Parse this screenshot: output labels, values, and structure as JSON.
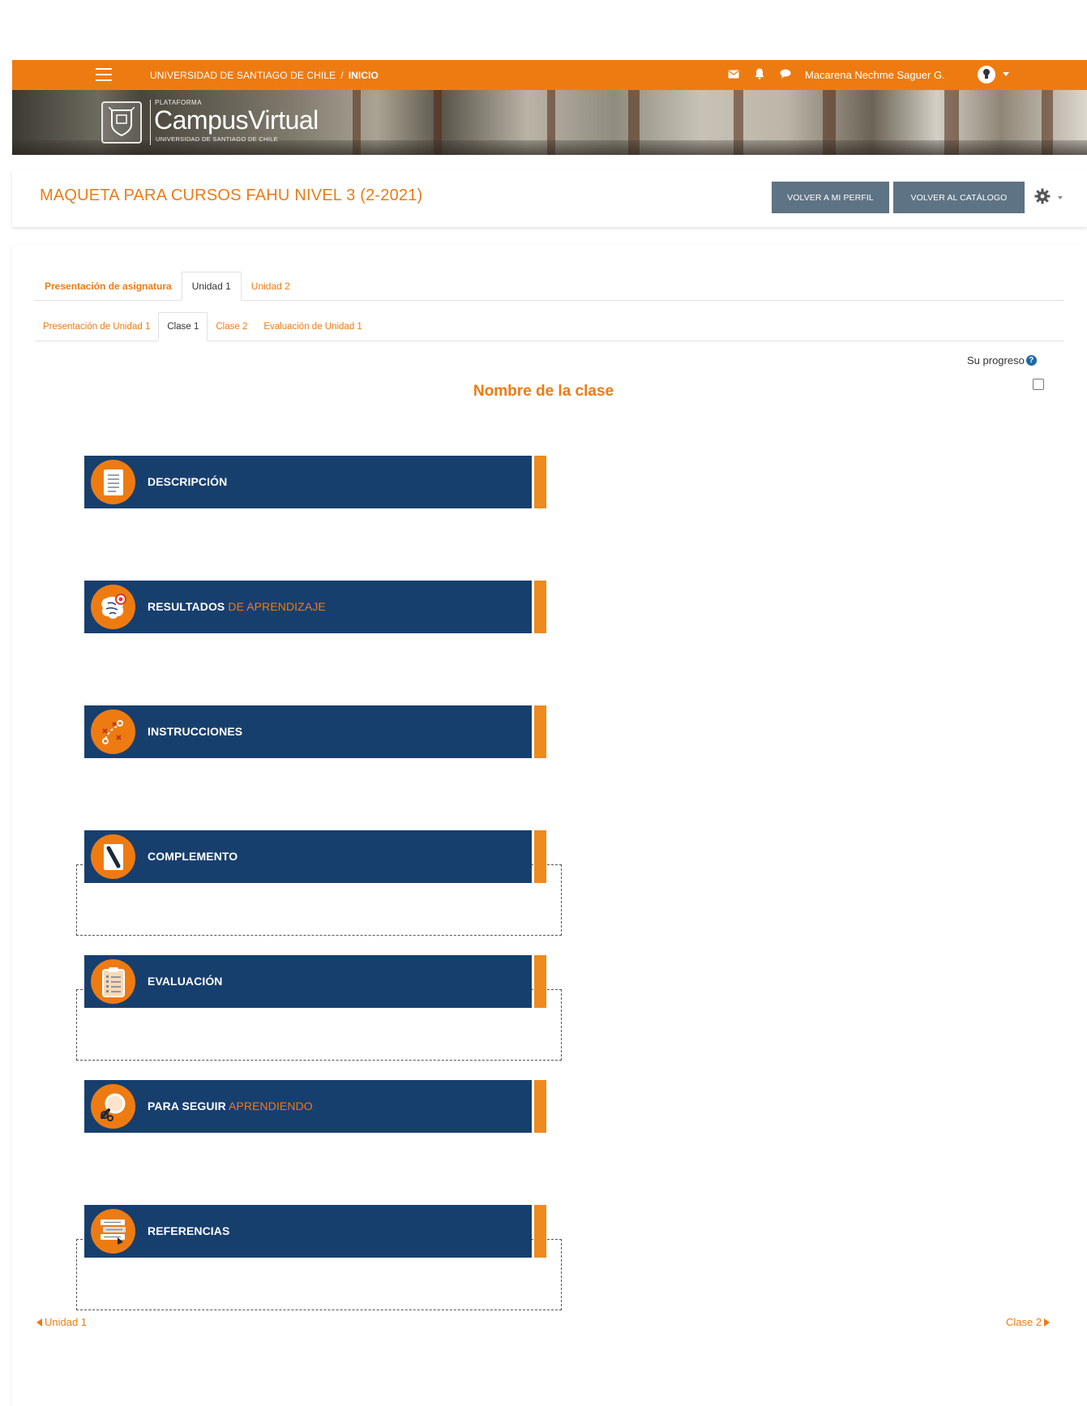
{
  "topbar": {
    "crumb_root": "UNIVERSIDAD DE SANTIAGO DE CHILE",
    "crumb_separator": "/",
    "crumb_current": "INICIO",
    "user_name": "Macarena Nechme Saguer G.",
    "icons": [
      "menu-icon",
      "envelope-icon",
      "bell-icon",
      "chat-icon",
      "user-avatar-icon",
      "caret-down-icon"
    ],
    "bg_color": "#ee7b12"
  },
  "banner": {
    "logo_small": "PLATAFORMA",
    "logo_main": "CampusVirtual",
    "logo_sub": "UNIVERSIDAD DE SANTIAGO DE CHILE"
  },
  "course": {
    "title": "MAQUETA PARA CURSOS FAHU NIVEL 3 (2-2021)",
    "btn_profile": "VOLVER A MI PERFIL",
    "btn_catalog": "VOLVER AL CATÁLOGO",
    "title_color": "#ee7b12",
    "button_color": "#5e7384"
  },
  "tabs_level1": [
    {
      "label": "Presentación de asignatura",
      "active": false
    },
    {
      "label": "Unidad 1",
      "active": true
    },
    {
      "label": "Unidad 2",
      "active": false
    }
  ],
  "tabs_level2": [
    {
      "label": "Presentación de Unidad 1",
      "active": false
    },
    {
      "label": "Clase 1",
      "active": true
    },
    {
      "label": "Clase 2",
      "active": false
    },
    {
      "label": "Evaluación de Unidad 1",
      "active": false
    }
  ],
  "progress": {
    "label": "Su progreso",
    "help": "?"
  },
  "section": {
    "title": "Nombre de la clase"
  },
  "activities": [
    {
      "main": "DESCRIPCIÓN",
      "accent": "",
      "icon": "document-icon",
      "dashed": false
    },
    {
      "main": "RESULTADOS",
      "accent": " DE APRENDIZAJE",
      "icon": "brain-target-icon",
      "dashed": false
    },
    {
      "main": "INSTRUCCIONES",
      "accent": "",
      "icon": "strategy-icon",
      "dashed": false
    },
    {
      "main": "COMPLEMENTO",
      "accent": "",
      "icon": "pencil-icon",
      "dashed": true
    },
    {
      "main": "EVALUACIÓN",
      "accent": "",
      "icon": "clipboard-icon",
      "dashed": true
    },
    {
      "main": "PARA SEGUIR",
      "accent": " APRENDIENDO",
      "icon": "magnifier-gears-icon",
      "dashed": false
    },
    {
      "main": "REFERENCIAS",
      "accent": "",
      "icon": "books-icon",
      "dashed": true
    }
  ],
  "navigation": {
    "prev": "Unidad 1",
    "next": "Clase 2"
  },
  "colors": {
    "accent": "#ee7b12",
    "bar": "#173f6e",
    "tip": "#ee8a1e"
  }
}
